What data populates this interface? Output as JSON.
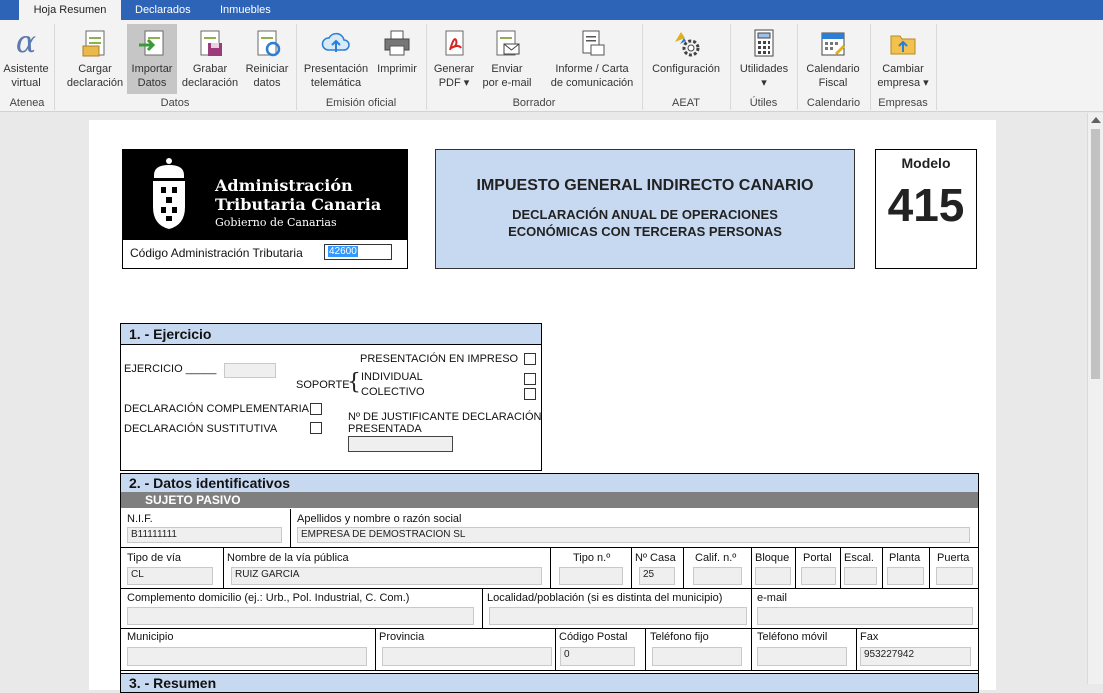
{
  "tabs": [
    "Hoja Resumen",
    "Declarados",
    "Inmuebles"
  ],
  "ribbon": {
    "buttons": [
      {
        "id": "asistente",
        "label": "Asistente\nvirtual",
        "icon": "alpha-icon"
      },
      {
        "id": "cargar",
        "label": "Cargar\ndeclaración",
        "icon": "load-doc-icon"
      },
      {
        "id": "importar",
        "label": "Importar\nDatos",
        "icon": "import-icon"
      },
      {
        "id": "grabar",
        "label": "Grabar\ndeclaración",
        "icon": "save-doc-icon"
      },
      {
        "id": "reiniciar",
        "label": "Reiniciar\ndatos",
        "icon": "reset-doc-icon"
      },
      {
        "id": "presentacion",
        "label": "Presentación\ntelemática",
        "icon": "cloud-upload-icon"
      },
      {
        "id": "imprimir",
        "label": "Imprimir",
        "icon": "printer-icon"
      },
      {
        "id": "generar",
        "label": "Generar\nPDF ▾",
        "icon": "pdf-icon"
      },
      {
        "id": "enviar",
        "label": "Enviar\npor e-mail",
        "icon": "email-doc-icon"
      },
      {
        "id": "informe",
        "label": "Informe / Carta\nde comunicación",
        "icon": "report-icon"
      },
      {
        "id": "configuracion",
        "label": "Configuración",
        "icon": "gear-icon"
      },
      {
        "id": "utilidades",
        "label": "Utilidades\n▾",
        "icon": "calculator-icon"
      },
      {
        "id": "calendario",
        "label": "Calendario\nFiscal",
        "icon": "calendar-icon"
      },
      {
        "id": "cambiar",
        "label": "Cambiar\nempresa ▾",
        "icon": "folder-icon"
      }
    ],
    "groups": [
      "Atenea",
      "Datos",
      "Emisión oficial",
      "Borrador",
      "AEAT",
      "Útiles",
      "Calendario",
      "Empresas"
    ]
  },
  "form": {
    "logo": {
      "line1": "Administración",
      "line2": "Tributaria Canaria",
      "line3": "Gobierno de Canarias"
    },
    "codigo_label": "Código Administración Tributaria",
    "codigo_value": "42600",
    "title": "IMPUESTO GENERAL INDIRECTO CANARIO",
    "subtitle1": "DECLARACIÓN ANUAL DE OPERACIONES",
    "subtitle2": "ECONÓMICAS CON TERCERAS PERSONAS",
    "modelo_label": "Modelo",
    "modelo_number": "415",
    "sec1": {
      "title": "1. - Ejercicio",
      "ejercicio": "EJERCICIO _____",
      "presentacion_impreso": "PRESENTACIÓN EN IMPRESO",
      "soporte": "SOPORTE",
      "individual": "INDIVIDUAL",
      "colectivo": "COLECTIVO",
      "complementaria": "DECLARACIÓN COMPLEMENTARIA",
      "sustitutiva": "DECLARACIÓN SUSTITUTIVA",
      "justificante1": "Nº DE JUSTIFICANTE DECLARACIÓN",
      "justificante2": "PRESENTADA"
    },
    "sec2": {
      "title": "2. - Datos identificativos",
      "subtitle": "SUJETO PASIVO",
      "labels": {
        "nif": "N.I.F.",
        "nombre": "Apellidos y nombre o razón social",
        "tipo_via": "Tipo de vía",
        "nombre_via": "Nombre de la vía pública",
        "tipo_n": "Tipo n.º",
        "n_casa": "Nº Casa",
        "calif": "Calif. n.º",
        "bloque": "Bloque",
        "portal": "Portal",
        "escal": "Escal.",
        "planta": "Planta",
        "puerta": "Puerta",
        "complemento": "Complemento domicilio (ej.: Urb., Pol. Industrial, C. Com.)",
        "localidad": "Localidad/población (si es distinta del municipio)",
        "email": "e-mail",
        "municipio": "Municipio",
        "provincia": "Provincia",
        "cp": "Código Postal",
        "tel_fijo": "Teléfono fijo",
        "tel_movil": "Teléfono móvil",
        "fax": "Fax"
      },
      "values": {
        "nif": "B11111111",
        "nombre": "EMPRESA DE DEMOSTRACION SL",
        "tipo_via": "CL",
        "nombre_via": "RUIZ GARCIA",
        "n_casa": "25",
        "cp": "0",
        "fax": "953227942"
      }
    },
    "sec3_title": "3. - Resumen"
  },
  "colors": {
    "accent": "#2e64b8",
    "section": "#c7d9f1",
    "subsection": "#7f7f7f"
  }
}
